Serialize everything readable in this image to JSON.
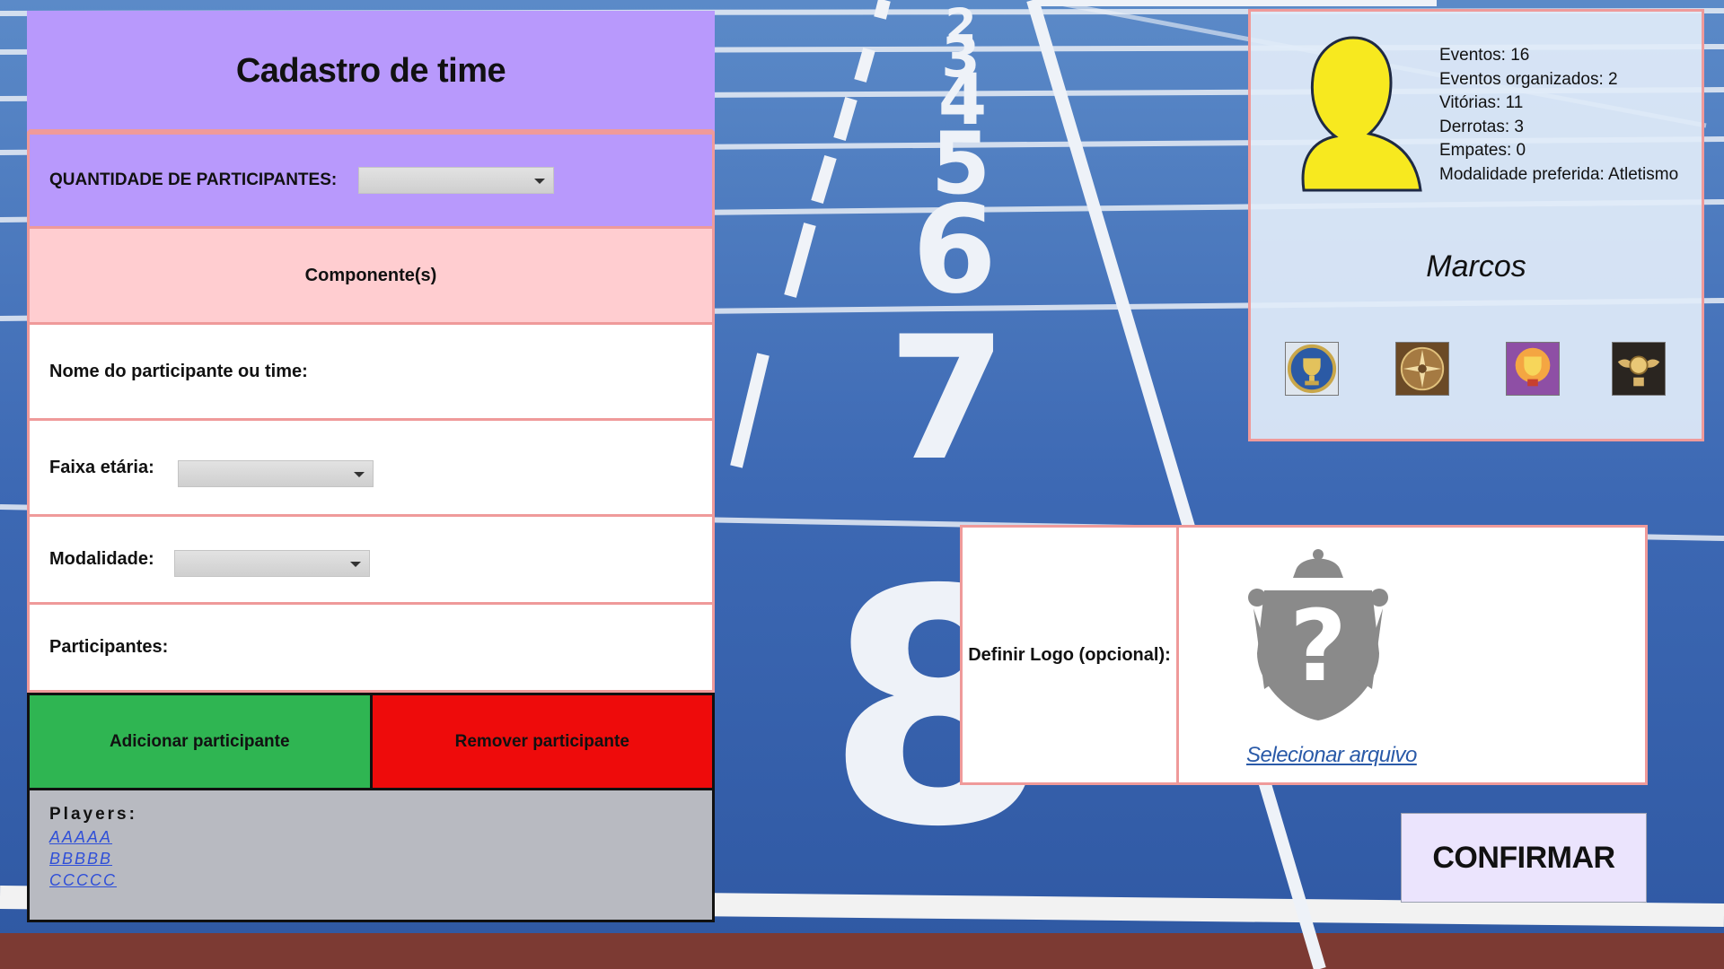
{
  "form": {
    "title": "Cadastro de time",
    "quantity_label": "QUANTIDADE DE PARTICIPANTES:",
    "quantity_value": "",
    "components_label": "Componente(s)",
    "name_label": "Nome do participante ou time:",
    "age_label": "Faixa etária:",
    "age_value": "",
    "modality_label": "Modalidade:",
    "modality_value": "",
    "participants_label": "Participantes:",
    "add_button": "Adicionar participante",
    "remove_button": "Remover participante",
    "players_title": "Players:",
    "players": [
      "AAAAA",
      "BBBBB",
      "CCCCC"
    ]
  },
  "profile": {
    "avatar_icon": "user-silhouette-icon",
    "stats": [
      "Eventos: 16",
      "Eventos organizados: 2",
      "Vitórias: 11",
      "Derrotas: 3",
      "Empates: 0",
      "Modalidade preferida: Atletismo"
    ],
    "name": "Marcos",
    "badges": [
      "trophy-badge-icon",
      "compass-badge-icon",
      "cup-badge-icon",
      "winged-medal-badge-icon"
    ]
  },
  "logo": {
    "label": "Definir Logo (opcional):",
    "placeholder_icon": "unknown-crest-icon",
    "select_link": "Selecionar arquivo"
  },
  "confirm_button": "CONFIRMAR",
  "colors": {
    "purple_header": "#b899fc",
    "pink_section": "#ffcdd0",
    "row_border": "#ef9a9a",
    "add_green": "#2fb552",
    "remove_red": "#ee0b0b",
    "players_gray": "#b8bac1",
    "confirm_bg": "#ebe4fd",
    "avatar_yellow": "#f7e91f",
    "track_blue": "#3a67b0"
  }
}
